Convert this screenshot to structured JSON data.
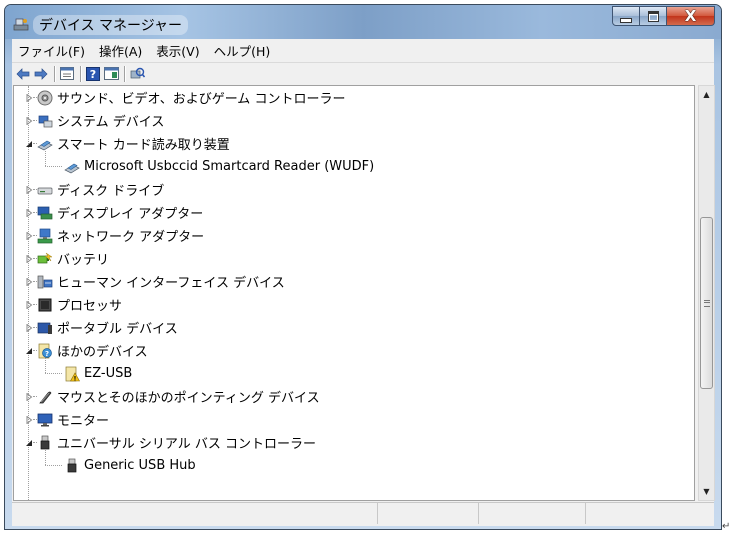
{
  "window": {
    "title": "デバイス マネージャー"
  },
  "caption_buttons": {
    "close_glyph": "X"
  },
  "menu": [
    {
      "label": "ファイル(F)"
    },
    {
      "label": "操作(A)"
    },
    {
      "label": "表示(V)"
    },
    {
      "label": "ヘルプ(H)"
    }
  ],
  "toolbar": [
    {
      "icon": "back-arrow-icon"
    },
    {
      "icon": "forward-arrow-icon"
    },
    {
      "icon": "properties-icon"
    },
    {
      "icon": "help-icon"
    },
    {
      "icon": "view-icon"
    },
    {
      "icon": "scan-hardware-icon"
    }
  ],
  "tree": [
    {
      "label": "サウンド、ビデオ、およびゲーム コントローラー",
      "level": 0,
      "expand": "collapsed",
      "icon": "sound-icon"
    },
    {
      "label": "システム デバイス",
      "level": 0,
      "expand": "collapsed",
      "icon": "system-device-icon"
    },
    {
      "label": "スマート カード読み取り装置",
      "level": 0,
      "expand": "expanded",
      "icon": "smart-card-reader-icon"
    },
    {
      "label": "Microsoft Usbccid Smartcard Reader (WUDF)",
      "level": 1,
      "expand": "none",
      "icon": "smart-card-reader-icon"
    },
    {
      "label": "ディスク ドライブ",
      "level": 0,
      "expand": "collapsed",
      "icon": "disk-drive-icon"
    },
    {
      "label": "ディスプレイ アダプター",
      "level": 0,
      "expand": "collapsed",
      "icon": "display-adapter-icon"
    },
    {
      "label": "ネットワーク アダプター",
      "level": 0,
      "expand": "collapsed",
      "icon": "network-adapter-icon"
    },
    {
      "label": "バッテリ",
      "level": 0,
      "expand": "collapsed",
      "icon": "battery-icon"
    },
    {
      "label": "ヒューマン インターフェイス デバイス",
      "level": 0,
      "expand": "collapsed",
      "icon": "hid-icon"
    },
    {
      "label": "プロセッサ",
      "level": 0,
      "expand": "collapsed",
      "icon": "processor-icon"
    },
    {
      "label": "ポータブル デバイス",
      "level": 0,
      "expand": "collapsed",
      "icon": "portable-device-icon"
    },
    {
      "label": "ほかのデバイス",
      "level": 0,
      "expand": "expanded",
      "icon": "unknown-device-icon"
    },
    {
      "label": "EZ-USB",
      "level": 1,
      "expand": "none",
      "icon": "unknown-device-warning-icon"
    },
    {
      "label": "マウスとそのほかのポインティング デバイス",
      "level": 0,
      "expand": "collapsed",
      "icon": "mouse-icon"
    },
    {
      "label": "モニター",
      "level": 0,
      "expand": "collapsed",
      "icon": "monitor-icon"
    },
    {
      "label": "ユニバーサル シリアル バス コントローラー",
      "level": 0,
      "expand": "expanded",
      "icon": "usb-icon"
    },
    {
      "label": "Generic USB Hub",
      "level": 1,
      "expand": "none",
      "icon": "usb-icon"
    }
  ],
  "colors": {
    "title_gradient": "#8aaad0",
    "close_button": "#c2341a",
    "tree_background": "#ffffff",
    "chrome_background": "#f0f0f0"
  }
}
